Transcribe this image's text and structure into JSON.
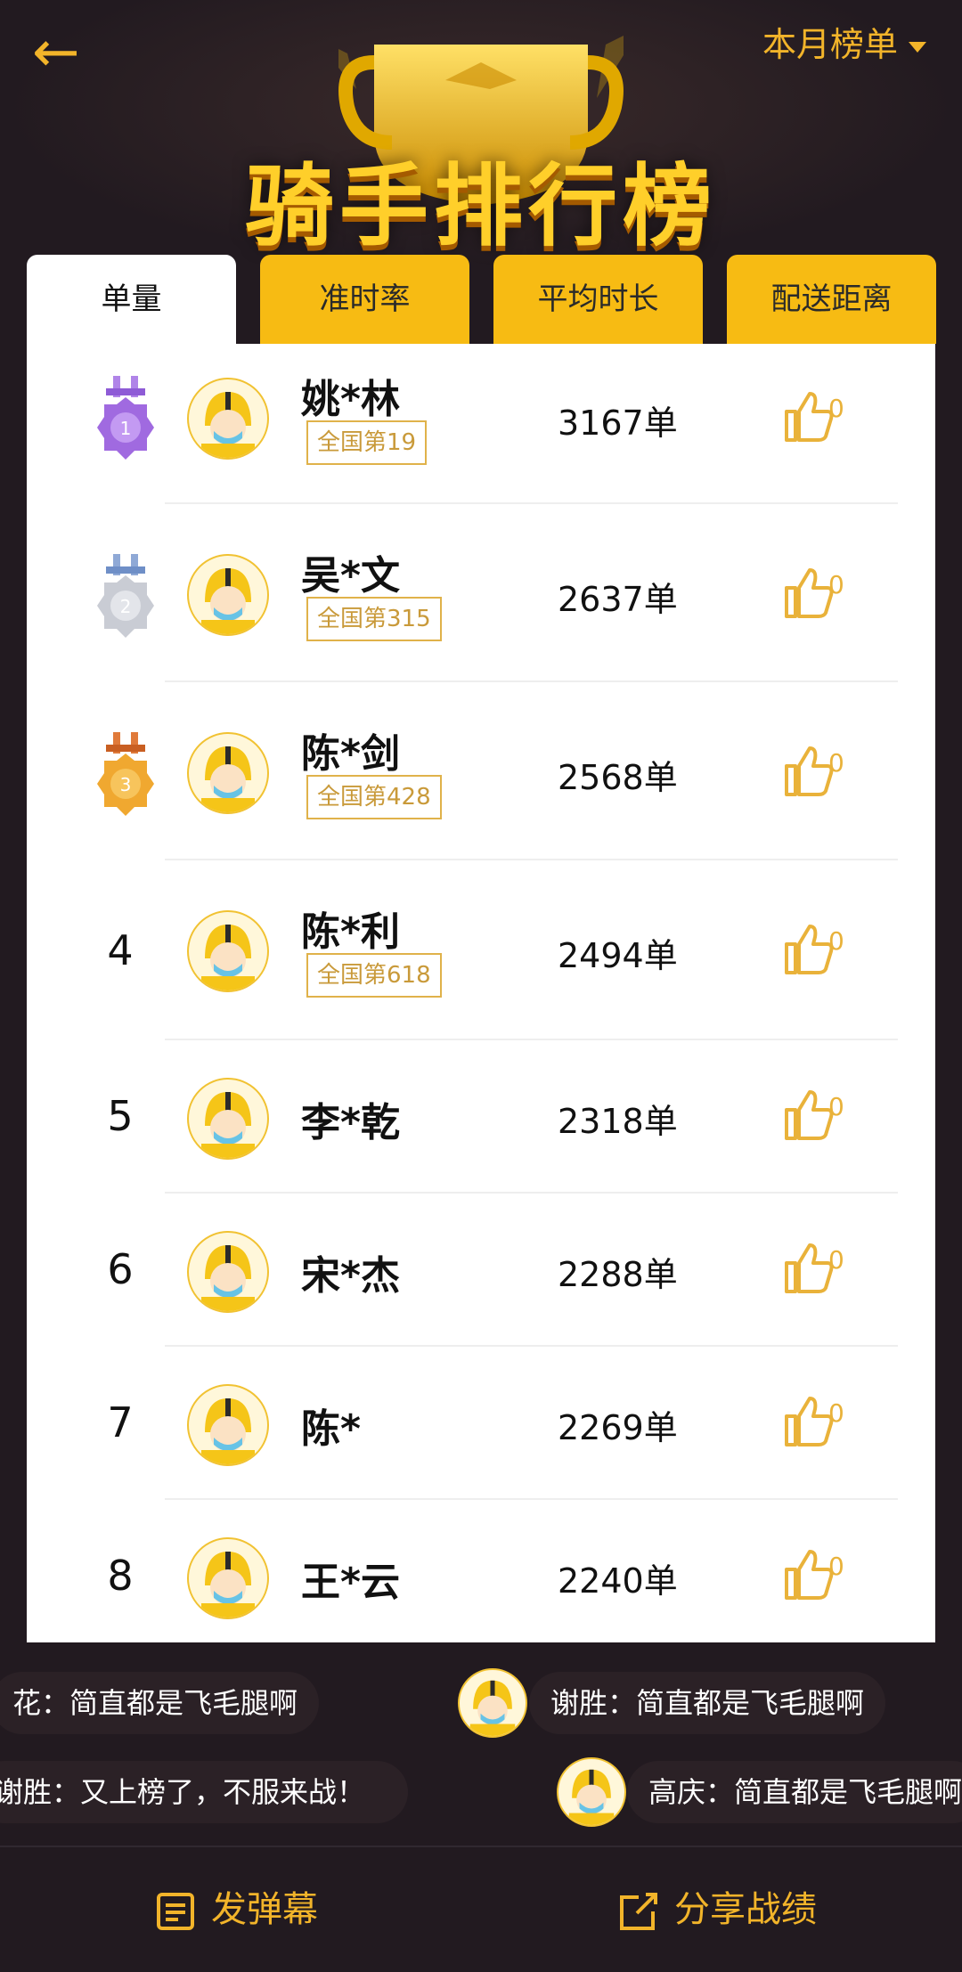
{
  "header": {
    "back_icon": "←",
    "period_label": "本月榜单",
    "title": "骑手排行榜"
  },
  "tabs": [
    {
      "label": "单量",
      "active": true
    },
    {
      "label": "准时率",
      "active": false
    },
    {
      "label": "平均时长",
      "active": false
    },
    {
      "label": "配送距离",
      "active": false
    }
  ],
  "riders": [
    {
      "rank": "1",
      "medal": "gold-purple-medal-icon",
      "name": "姚*林",
      "national_rank": "全国第19",
      "orders": "3167单",
      "likes": "0"
    },
    {
      "rank": "2",
      "medal": "silver-medal-icon",
      "name": "吴*文",
      "national_rank": "全国第315",
      "orders": "2637单",
      "likes": "0"
    },
    {
      "rank": "3",
      "medal": "bronze-medal-icon",
      "name": "陈*剑",
      "national_rank": "全国第428",
      "orders": "2568单",
      "likes": "0"
    },
    {
      "rank": "4",
      "name": "陈*利",
      "national_rank": "全国第618",
      "orders": "2494单",
      "likes": "0"
    },
    {
      "rank": "5",
      "name": "李*乾",
      "orders": "2318单",
      "likes": "0"
    },
    {
      "rank": "6",
      "name": "宋*杰",
      "orders": "2288单",
      "likes": "0"
    },
    {
      "rank": "7",
      "name": "陈*",
      "orders": "2269单",
      "likes": "0"
    },
    {
      "rank": "8",
      "name": "王*云",
      "orders": "2240单",
      "likes": "0"
    }
  ],
  "danmu": [
    "花：简直都是飞毛腿啊",
    "谢胜：简直都是飞毛腿啊",
    "谢胜：又上榜了，不服来战！",
    "高庆：简直都是飞毛腿啊"
  ],
  "bottom": {
    "send_danmu": "发弹幕",
    "share": "分享战绩"
  },
  "colors": {
    "accent": "#f7bb13",
    "background": "#221a20",
    "badge_border": "#e0b24a"
  }
}
